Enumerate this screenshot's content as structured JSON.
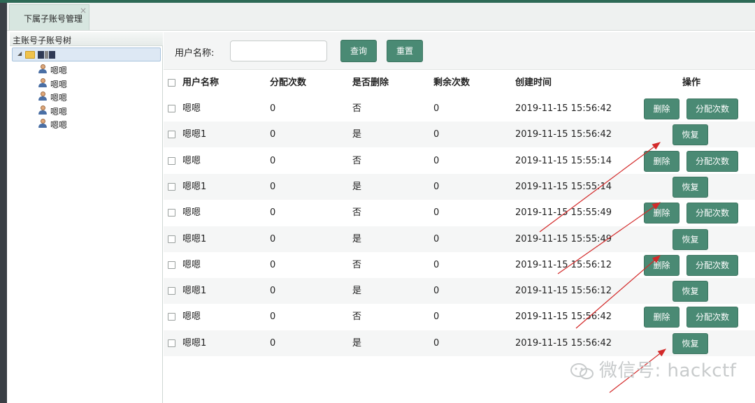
{
  "tab": {
    "label": "下属子账号管理",
    "close": "×"
  },
  "tree": {
    "title": "主账号子账号树",
    "children": [
      "嗯嗯",
      "嗯嗯",
      "嗯嗯",
      "嗯嗯",
      "嗯嗯"
    ]
  },
  "search": {
    "label": "用户名称:",
    "value": "",
    "placeholder": "",
    "query_label": "查询",
    "reset_label": "重置"
  },
  "table": {
    "headers": {
      "name": "用户名称",
      "alloc": "分配次数",
      "deleted": "是否删除",
      "remaining": "剩余次数",
      "created": "创建时间",
      "ops": "操作"
    },
    "rows": [
      {
        "name": "嗯嗯",
        "alloc": "0",
        "deleted": "否",
        "remaining": "0",
        "created": "2019-11-15 15:56:42"
      },
      {
        "name": "嗯嗯1",
        "alloc": "0",
        "deleted": "是",
        "remaining": "0",
        "created": "2019-11-15 15:56:42"
      },
      {
        "name": "嗯嗯",
        "alloc": "0",
        "deleted": "否",
        "remaining": "0",
        "created": "2019-11-15 15:55:14"
      },
      {
        "name": "嗯嗯1",
        "alloc": "0",
        "deleted": "是",
        "remaining": "0",
        "created": "2019-11-15 15:55:14"
      },
      {
        "name": "嗯嗯",
        "alloc": "0",
        "deleted": "否",
        "remaining": "0",
        "created": "2019-11-15 15:55:49"
      },
      {
        "name": "嗯嗯1",
        "alloc": "0",
        "deleted": "是",
        "remaining": "0",
        "created": "2019-11-15 15:55:49"
      },
      {
        "name": "嗯嗯",
        "alloc": "0",
        "deleted": "否",
        "remaining": "0",
        "created": "2019-11-15 15:56:12"
      },
      {
        "name": "嗯嗯1",
        "alloc": "0",
        "deleted": "是",
        "remaining": "0",
        "created": "2019-11-15 15:56:12"
      },
      {
        "name": "嗯嗯",
        "alloc": "0",
        "deleted": "否",
        "remaining": "0",
        "created": "2019-11-15 15:56:42"
      },
      {
        "name": "嗯嗯1",
        "alloc": "0",
        "deleted": "是",
        "remaining": "0",
        "created": "2019-11-15 15:56:42"
      }
    ],
    "delete_label": "删除",
    "alloc_label": "分配次数",
    "restore_label": "恢复"
  },
  "watermark": "微信号: hackctf",
  "colors": {
    "accent": "#4a8a74",
    "arrow": "#d32a2a"
  }
}
